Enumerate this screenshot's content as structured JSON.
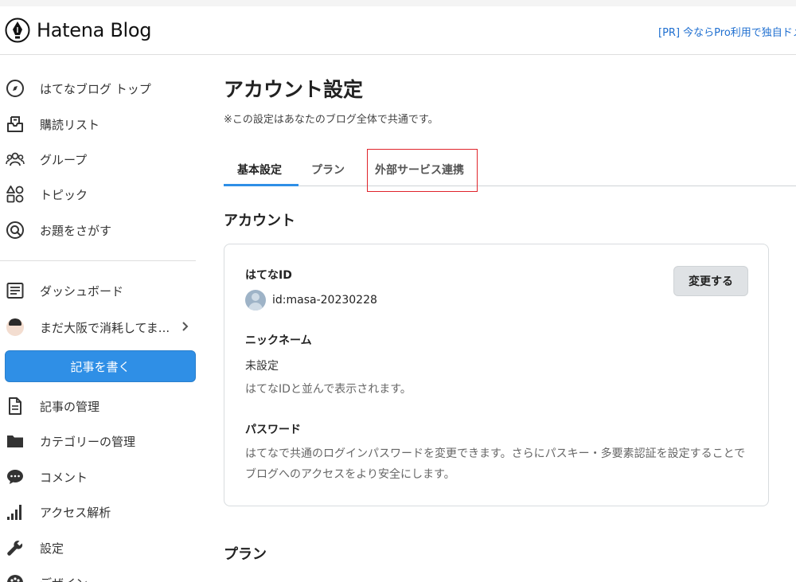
{
  "header": {
    "logo_text": "Hatena Blog",
    "pr_link": "[PR] 今ならPro利用で独自ドメ"
  },
  "sidebar": {
    "items_top": [
      {
        "label": "はてなブログ トップ",
        "icon": "compass-icon"
      },
      {
        "label": "購読リスト",
        "icon": "inbox-icon"
      },
      {
        "label": "グループ",
        "icon": "group-icon"
      },
      {
        "label": "トピック",
        "icon": "shapes-icon"
      },
      {
        "label": "お題をさがす",
        "icon": "q-search-icon"
      }
    ],
    "items_blog": [
      {
        "label": "ダッシュボード",
        "icon": "dashboard-icon"
      },
      {
        "label": "まだ大阪で消耗してま...",
        "icon": "blog-avatar"
      }
    ],
    "write_button": "記事を書く",
    "items_manage": [
      {
        "label": "記事の管理",
        "icon": "document-icon"
      },
      {
        "label": "カテゴリーの管理",
        "icon": "folder-icon"
      },
      {
        "label": "コメント",
        "icon": "comment-icon"
      },
      {
        "label": "アクセス解析",
        "icon": "bar-signal-icon"
      },
      {
        "label": "設定",
        "icon": "wrench-icon"
      },
      {
        "label": "デザイン",
        "icon": "palette-icon"
      }
    ]
  },
  "main": {
    "title": "アカウント設定",
    "note": "※この設定はあなたのブログ全体で共通です。",
    "tabs": [
      {
        "label": "基本設定",
        "active": true
      },
      {
        "label": "プラン",
        "active": false
      },
      {
        "label": "外部サービス連携",
        "active": false
      }
    ],
    "account_section": {
      "title": "アカウント",
      "hatena_id_label": "はてなID",
      "hatena_id_value": "id:masa-20230228",
      "change_button": "変更する",
      "nickname_label": "ニックネーム",
      "nickname_value": "未設定",
      "nickname_help": "はてなIDと並んで表示されます。",
      "password_label": "パスワード",
      "password_help": "はてなで共通のログインパスワードを変更できます。さらにパスキー・多要素認証を設定することでブログへのアクセスをより安全にします。"
    },
    "plan_section": {
      "title": "プラン"
    }
  },
  "colors": {
    "accent": "#2f8fe6",
    "highlight": "#e0242b",
    "link": "#1f6fd0"
  }
}
